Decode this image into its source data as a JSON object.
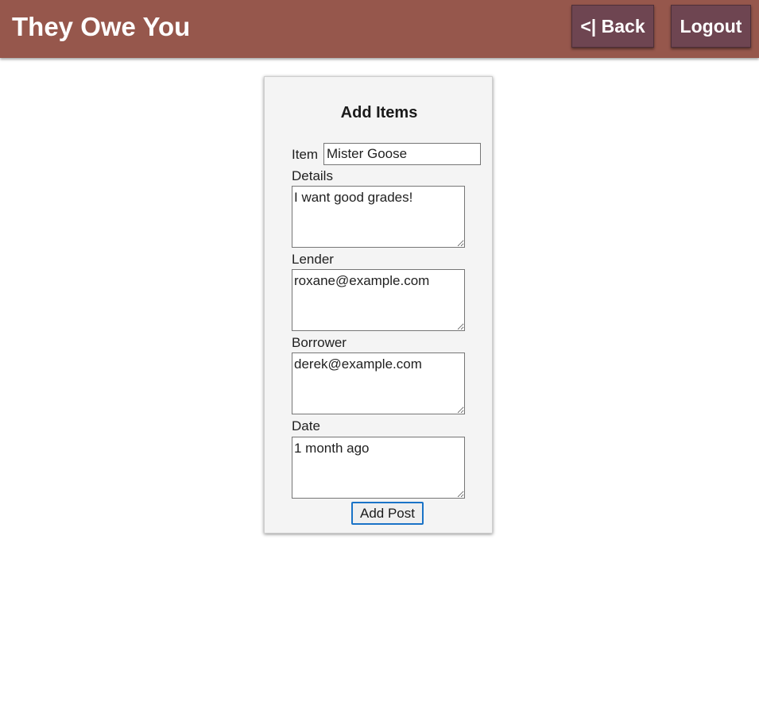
{
  "header": {
    "title": "They Owe You",
    "back_label": "<| Back",
    "logout_label": "Logout",
    "bar_color": "#96574c",
    "button_color": "#6e4551"
  },
  "form": {
    "title": "Add Items",
    "item_label": "Item",
    "item_value": "Mister Goose",
    "details_label": "Details",
    "details_value": "I want good grades!",
    "lender_label": "Lender",
    "lender_value": "roxane@example.com",
    "borrower_label": "Borrower",
    "borrower_value": "derek@example.com",
    "date_label": "Date",
    "date_value": "1 month ago",
    "submit_label": "Add Post"
  }
}
